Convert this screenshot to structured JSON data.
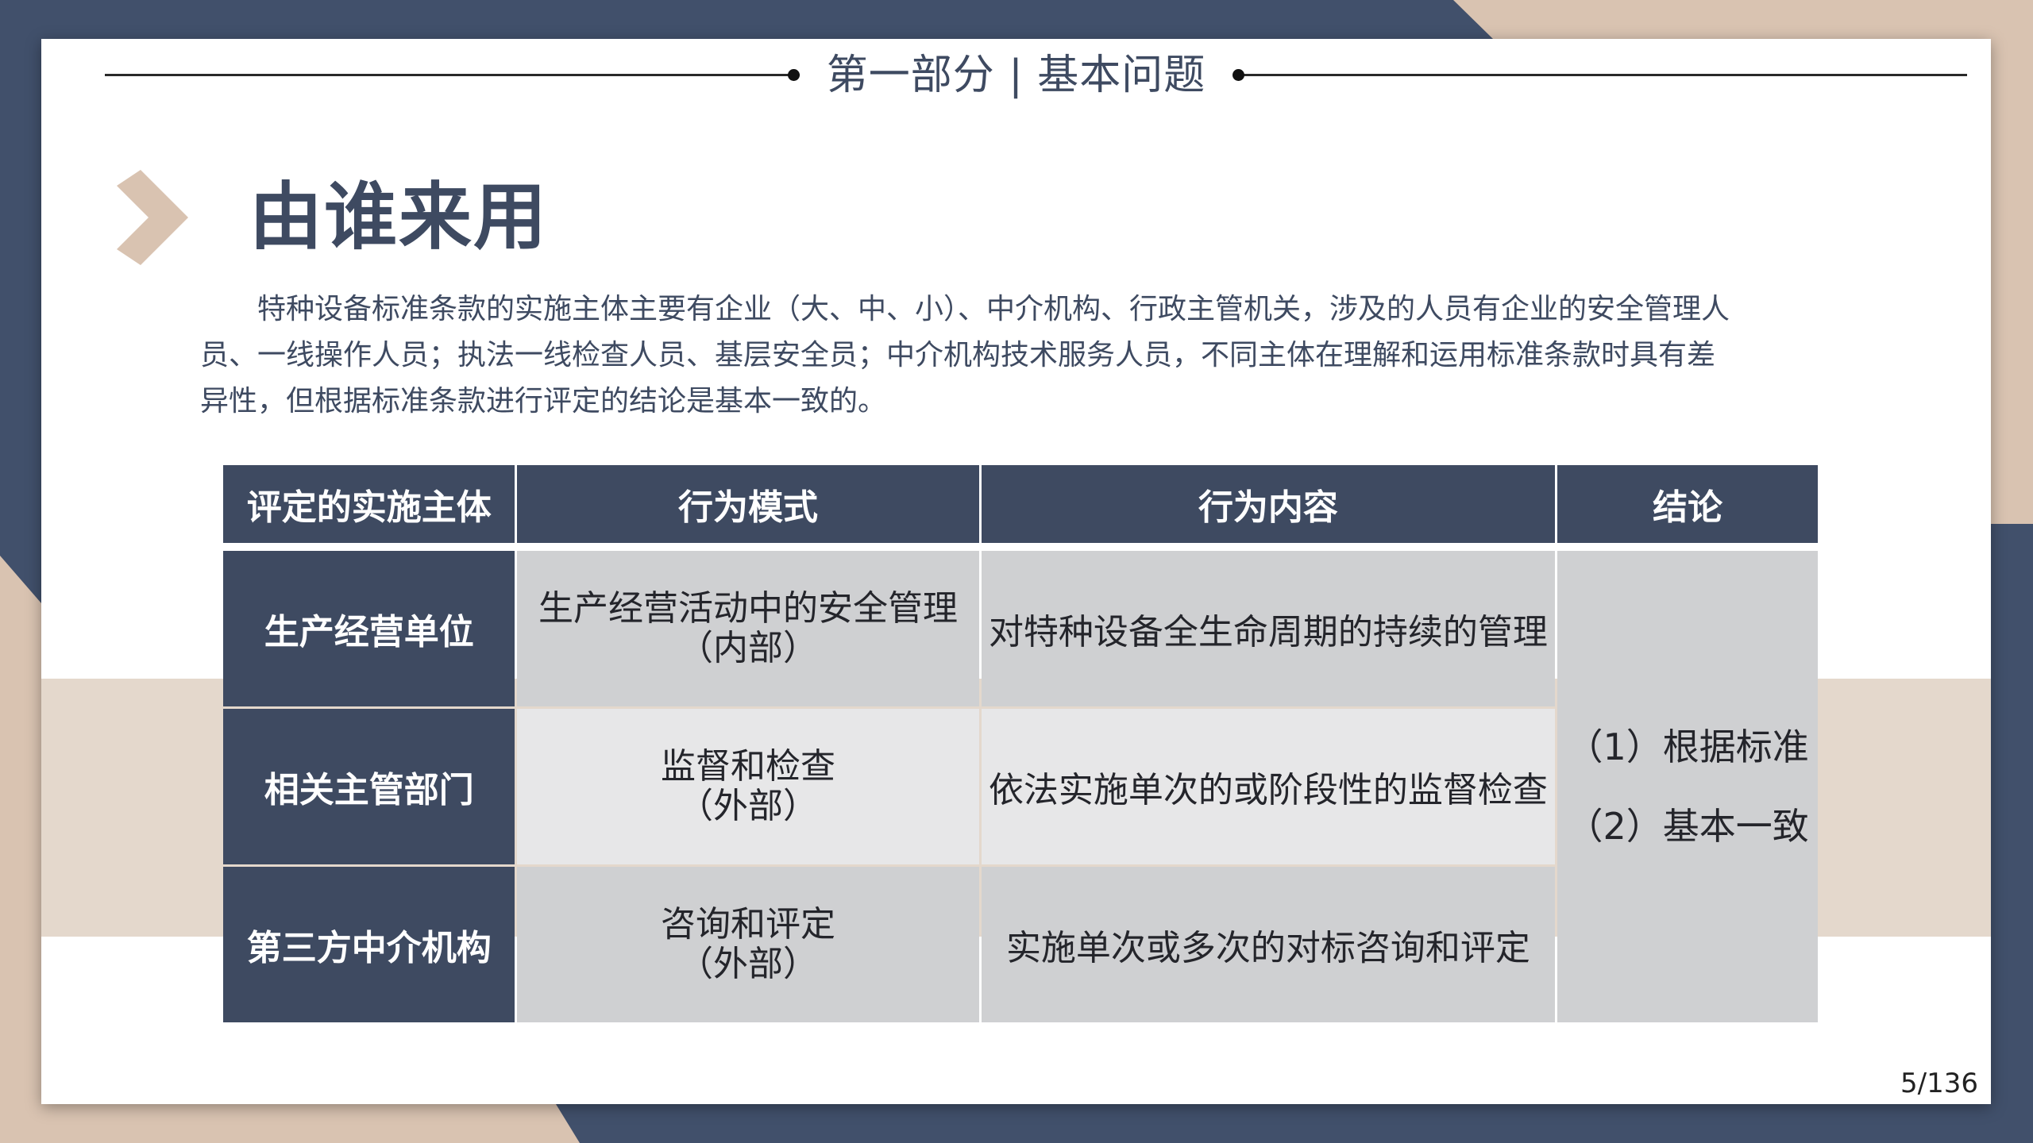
{
  "section_title": "第一部分 | 基本问题",
  "heading": "由谁来用",
  "body": "特种设备标准条款的实施主体主要有企业（大、中、小）、中介机构、行政主管机关，涉及的人员有企业的安全管理人员、一线操作人员；执法一线检查人员、基层安全员；中介机构技术服务人员，不同主体在理解和运用标准条款时具有差异性，但根据标准条款进行评定的结论是基本一致的。",
  "table": {
    "headers": [
      "评定的实施主体",
      "行为模式",
      "行为内容",
      "结论"
    ],
    "rows": [
      {
        "subject": "生产经营单位",
        "mode_line1": "生产经营活动中的安全管理",
        "mode_line2": "（内部）",
        "content": "对特种设备全生命周期的持续的管理"
      },
      {
        "subject": "相关主管部门",
        "mode_line1": "监督和检查",
        "mode_line2": "（外部）",
        "content": "依法实施单次的或阶段性的监督检查"
      },
      {
        "subject": "第三方中介机构",
        "mode_line1": "咨询和评定",
        "mode_line2": "（外部）",
        "content": "实施单次或多次的对标咨询和评定"
      }
    ],
    "conclusion": [
      "（1）根据标准",
      "（2）基本一致"
    ]
  },
  "page_number": "5/136",
  "colors": {
    "navy": "#3e4a61",
    "beige": "#d9c3b1",
    "gray_dark": "#cfd0d2",
    "gray_light": "#e7e7e8"
  }
}
